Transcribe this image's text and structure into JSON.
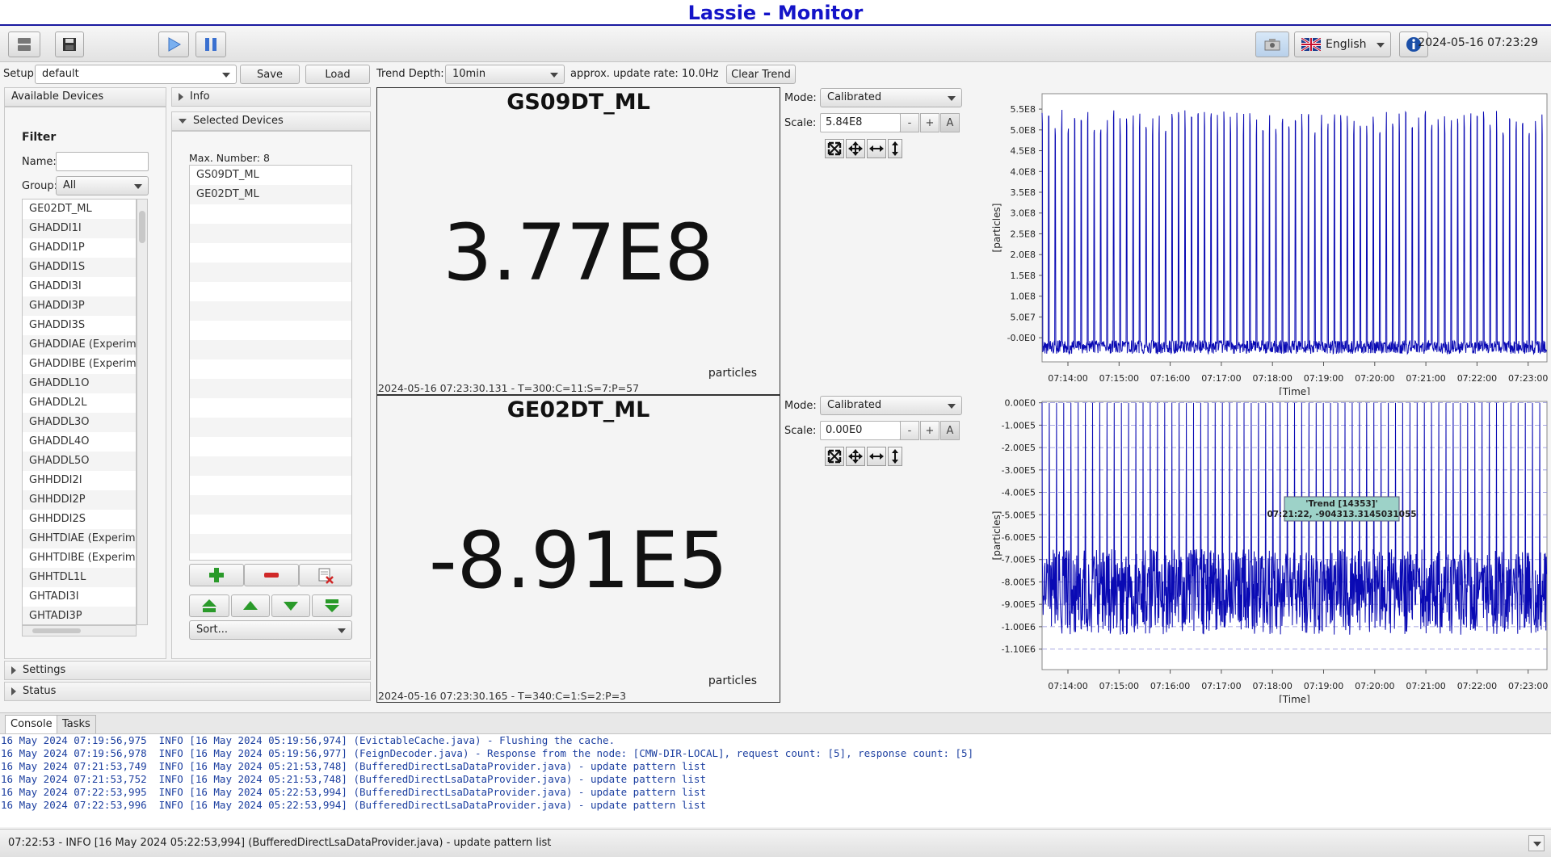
{
  "window": {
    "title": "Lassie - Monitor"
  },
  "toolbar": {
    "language": "English",
    "datetime": "2024-05-16 07:23:29"
  },
  "setup": {
    "label": "Setup:",
    "value": "default",
    "save_label": "Save",
    "load_label": "Load"
  },
  "trend": {
    "depth_label": "Trend Depth:",
    "depth_value": "10min",
    "rate_text": "approx. update rate:  10.0Hz",
    "clear_label": "Clear Trend"
  },
  "available": {
    "header": "Available Devices",
    "filter_title": "Filter",
    "name_label": "Name:",
    "name_value": "",
    "group_label": "Group:",
    "group_value": "All",
    "devices": [
      "GE02DT_ML",
      "GHADDI1I",
      "GHADDI1P",
      "GHADDI1S",
      "GHADDI3I",
      "GHADDI3P",
      "GHADDI3S",
      "GHADDIAE (Experimer",
      "GHADDIBE (Experimer",
      "GHADDL1O",
      "GHADDL2L",
      "GHADDL3O",
      "GHADDL4O",
      "GHADDL5O",
      "GHHDDI2I",
      "GHHDDI2P",
      "GHHDDI2S",
      "GHHTDIAE (Experimer",
      "GHHTDIBE (Experimer",
      "GHHTDL1L",
      "GHTADI3I",
      "GHTADI3P"
    ]
  },
  "info_header": "Info",
  "selected": {
    "header": "Selected Devices",
    "max_number": "Max. Number: 8",
    "devices": [
      "GS09DT_ML",
      "GE02DT_ML",
      "",
      "",
      "",
      "",
      "",
      "",
      "",
      "",
      "",
      "",
      "",
      "",
      "",
      "",
      "",
      "",
      "",
      ""
    ],
    "sort_label": "Sort..."
  },
  "settings_header": "Settings",
  "status_header": "Status",
  "panels": [
    {
      "device": "GS09DT_ML",
      "value": "3.77E8",
      "unit": "particles",
      "meta": "2024-05-16 07:23:30.131 - T=300:C=11:S=7:P=57",
      "mode_label": "Mode:",
      "mode": "Calibrated",
      "scale_label": "Scale:",
      "scale": "5.84E8",
      "minus": "-",
      "plus": "+",
      "auto": "A"
    },
    {
      "device": "GE02DT_ML",
      "value": "-8.91E5",
      "unit": "particles",
      "meta": "2024-05-16 07:23:30.165 - T=340:C=1:S=2:P=3",
      "mode_label": "Mode:",
      "mode": "Calibrated",
      "scale_label": "Scale:",
      "scale": "0.00E0",
      "minus": "-",
      "plus": "+",
      "auto": "A"
    }
  ],
  "chart_data": [
    {
      "type": "line",
      "series": [
        {
          "values_description_free": true
        }
      ],
      "ylabel": "[particles]",
      "xlabel": "[Time]",
      "x_ticks": [
        "07:14:00",
        "07:15:00",
        "07:16:00",
        "07:17:00",
        "07:18:00",
        "07:19:00",
        "07:20:00",
        "07:21:00",
        "07:22:00",
        "07:23:00"
      ],
      "y_ticks": [
        "-0.0E0",
        "5.0E7",
        "1.0E8",
        "1.5E8",
        "2.0E8",
        "2.5E8",
        "3.0E8",
        "3.5E8",
        "4.0E8",
        "4.5E8",
        "5.0E8",
        "5.5E8"
      ],
      "ylim": [
        -10000000,
        580000000
      ],
      "grid": false,
      "color": "#0a0ab4"
    },
    {
      "type": "line",
      "ylabel": "[particles]",
      "xlabel": "[Time]",
      "x_ticks": [
        "07:14:00",
        "07:15:00",
        "07:16:00",
        "07:17:00",
        "07:18:00",
        "07:19:00",
        "07:20:00",
        "07:21:00",
        "07:22:00",
        "07:23:00"
      ],
      "y_ticks": [
        "0.00E0",
        "-1.00E5",
        "-2.00E5",
        "-3.00E5",
        "-4.00E5",
        "-5.00E5",
        "-6.00E5",
        "-7.00E5",
        "-8.00E5",
        "-9.00E5",
        "-1.00E6",
        "-1.10E6"
      ],
      "ylim": [
        -1200000,
        0
      ],
      "grid": true,
      "color": "#0a0ab4",
      "tooltip_title": "'Trend [14353]'",
      "tooltip_value": "07:21:22, -904313.3145031055"
    }
  ],
  "console": {
    "tabs": [
      "Console",
      "Tasks"
    ],
    "lines": [
      "16 May 2024 07:19:56,975  INFO [16 May 2024 05:19:56,974] (EvictableCache.java) - Flushing the cache.",
      "16 May 2024 07:19:56,978  INFO [16 May 2024 05:19:56,977] (FeignDecoder.java) - Response from the node: [CMW-DIR-LOCAL], request count: [5], response count: [5]",
      "16 May 2024 07:21:53,749  INFO [16 May 2024 05:21:53,748] (BufferedDirectLsaDataProvider.java) - update pattern list",
      "16 May 2024 07:21:53,752  INFO [16 May 2024 05:21:53,748] (BufferedDirectLsaDataProvider.java) - update pattern list",
      "16 May 2024 07:22:53,995  INFO [16 May 2024 05:22:53,994] (BufferedDirectLsaDataProvider.java) - update pattern list",
      "16 May 2024 07:22:53,996  INFO [16 May 2024 05:22:53,994] (BufferedDirectLsaDataProvider.java) - update pattern list"
    ]
  },
  "status": {
    "text": "07:22:53 -  INFO [16 May 2024 05:22:53,994] (BufferedDirectLsaDataProvider.java) - update pattern list"
  }
}
